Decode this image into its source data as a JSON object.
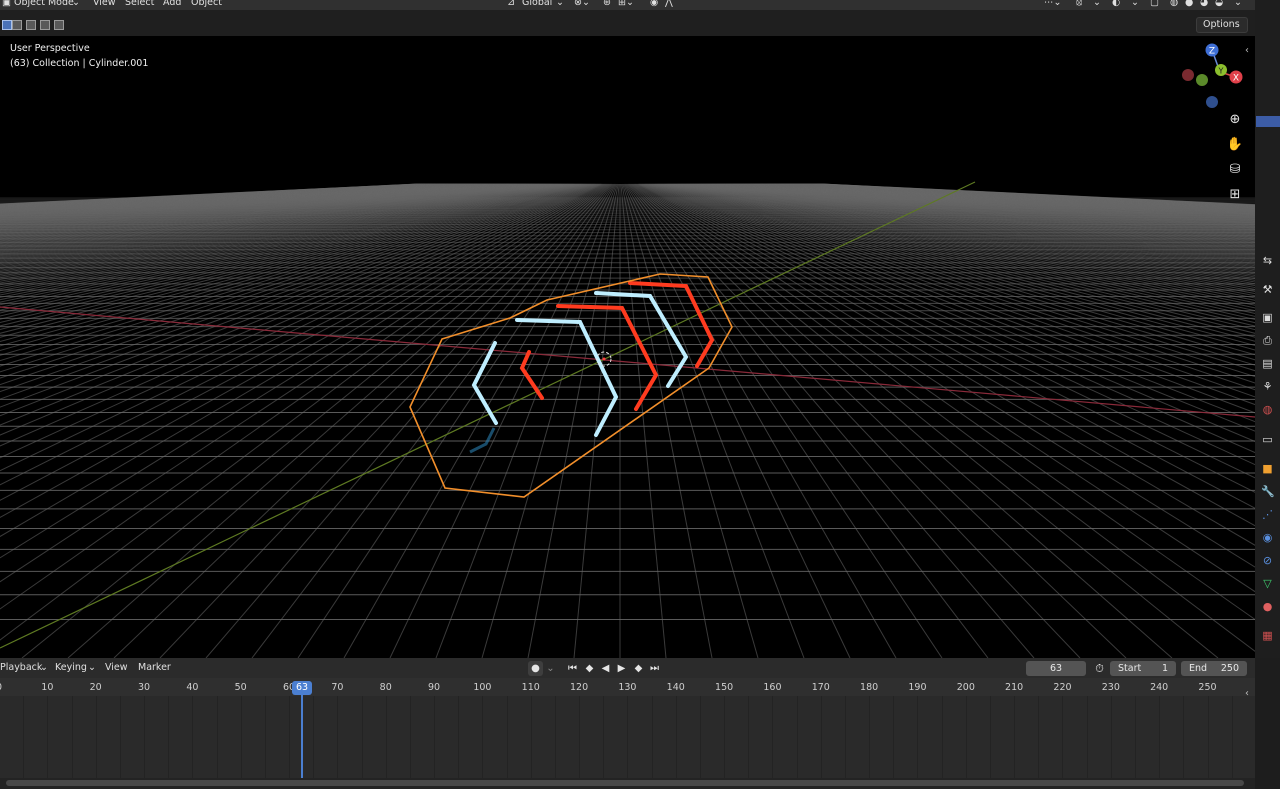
{
  "header": {
    "mode": "Object Mode",
    "menus": [
      "View",
      "Select",
      "Add",
      "Object"
    ],
    "orientation": "Global",
    "options_label": "Options"
  },
  "viewport": {
    "title": "User Perspective",
    "subtitle": "(63) Collection | Cylinder.001",
    "gizmo_axes": [
      "Z",
      "Y",
      "X"
    ],
    "nav_tools": [
      "zoom-icon",
      "hand-icon",
      "camera-icon",
      "grid-icon"
    ],
    "outline_color": "#f28f2b",
    "neon_blue": "#bfeeff",
    "neon_red": "#ff3b1f"
  },
  "properties_tabs": [
    "tool-icon",
    "render-icon",
    "output-icon",
    "view-layer-icon",
    "scene-icon",
    "world-icon",
    "collection-icon",
    "object-icon",
    "modifier-icon",
    "particles-icon",
    "physics-icon",
    "constraints-icon",
    "data-icon",
    "material-icon",
    "texture-icon"
  ],
  "timeline": {
    "menus": [
      "Playback",
      "Keying",
      "View",
      "Marker"
    ],
    "current_frame": "63",
    "start_label": "Start",
    "start_value": "1",
    "end_label": "End",
    "end_value": "250",
    "ticks": [
      "0",
      "10",
      "20",
      "30",
      "40",
      "50",
      "60",
      "70",
      "80",
      "90",
      "100",
      "110",
      "120",
      "130",
      "140",
      "150",
      "160",
      "170",
      "180",
      "190",
      "200",
      "210",
      "220",
      "230",
      "240",
      "250"
    ]
  }
}
